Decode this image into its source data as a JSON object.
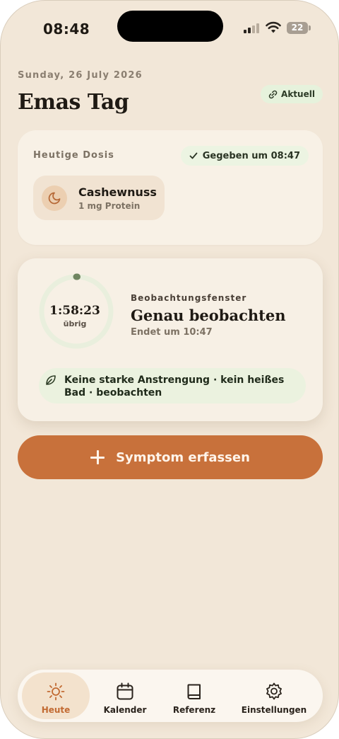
{
  "status_bar": {
    "time": "08:48",
    "battery": "22"
  },
  "header": {
    "date": "Sunday, 26 July 2026",
    "title": "Emas Tag",
    "current_badge": "Aktuell"
  },
  "dose_card": {
    "heading": "Heutige Dosis",
    "given_status": "Gegeben um 08:47",
    "food": {
      "name": "Cashewnuss",
      "amount": "1 mg Protein",
      "icon": "moon-icon"
    }
  },
  "observation_card": {
    "timer": "1:58:23",
    "timer_sub": "übrig",
    "label": "Beobachtungsfenster",
    "title": "Genau beobachten",
    "ends": "Endet um 10:47",
    "advice": "Keine starke Anstrengung · kein heißes Bad · beobachten",
    "remaining_fraction": 0.99
  },
  "symptom_button": {
    "label": "Symptom erfassen"
  },
  "tabs": [
    {
      "label": "Heute",
      "icon": "sun-icon",
      "active": true
    },
    {
      "label": "Kalender",
      "icon": "calendar-icon",
      "active": false
    },
    {
      "label": "Referenz",
      "icon": "book-icon",
      "active": false
    },
    {
      "label": "Einstellungen",
      "icon": "gear-icon",
      "active": false
    }
  ],
  "colors": {
    "accent": "#c8713b",
    "background": "#f2e7d8",
    "success_bg": "#e6f2dc",
    "ring": "#6f8560"
  }
}
